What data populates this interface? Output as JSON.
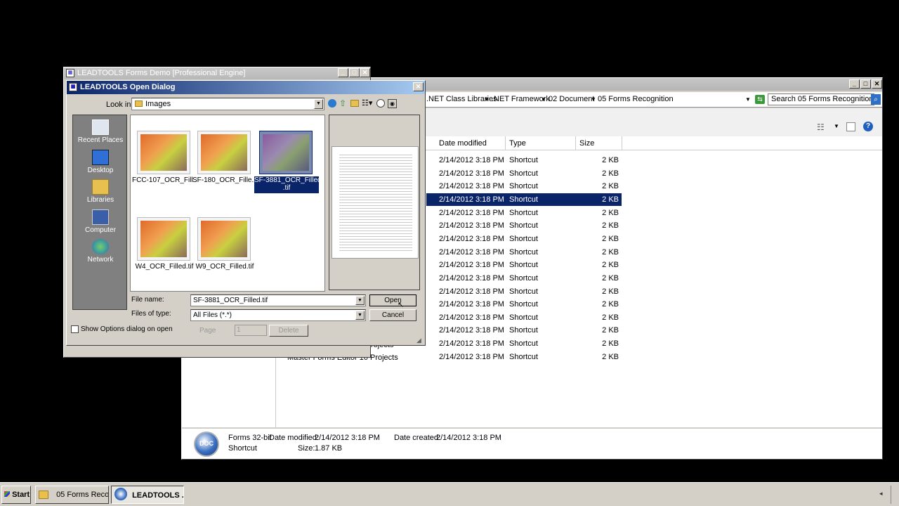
{
  "explorer": {
    "breadcrumb": [
      ".NET Class Libraries",
      ".NET Framework",
      "02 Document",
      "05 Forms Recognition"
    ],
    "search_placeholder": "Search 05 Forms Recognition",
    "columns": [
      "Date modified",
      "Type",
      "Size"
    ],
    "rows": [
      {
        "date": "2/14/2012 3:18 PM",
        "type": "Shortcut",
        "size": "2 KB"
      },
      {
        "date": "2/14/2012 3:18 PM",
        "type": "Shortcut",
        "size": "2 KB"
      },
      {
        "date": "2/14/2012 3:18 PM",
        "type": "Shortcut",
        "size": "2 KB"
      },
      {
        "date": "2/14/2012 3:18 PM",
        "type": "Shortcut",
        "size": "2 KB"
      },
      {
        "date": "2/14/2012 3:18 PM",
        "type": "Shortcut",
        "size": "2 KB"
      },
      {
        "date": "2/14/2012 3:18 PM",
        "type": "Shortcut",
        "size": "2 KB"
      },
      {
        "date": "2/14/2012 3:18 PM",
        "type": "Shortcut",
        "size": "2 KB"
      },
      {
        "date": "2/14/2012 3:18 PM",
        "type": "Shortcut",
        "size": "2 KB"
      },
      {
        "date": "2/14/2012 3:18 PM",
        "type": "Shortcut",
        "size": "2 KB"
      },
      {
        "date": "2/14/2012 3:18 PM",
        "type": "Shortcut",
        "size": "2 KB"
      },
      {
        "date": "2/14/2012 3:18 PM",
        "type": "Shortcut",
        "size": "2 KB"
      },
      {
        "date": "2/14/2012 3:18 PM",
        "type": "Shortcut",
        "size": "2 KB"
      },
      {
        "date": "2/14/2012 3:18 PM",
        "type": "Shortcut",
        "size": "2 KB"
      },
      {
        "date": "2/14/2012 3:18 PM",
        "type": "Shortcut",
        "size": "2 KB"
      },
      {
        "date": "2/14/2012 3:18 PM",
        "type": "Shortcut",
        "size": "2 KB"
      },
      {
        "date": "2/14/2012 3:18 PM",
        "type": "Shortcut",
        "size": "2 KB"
      }
    ],
    "partial_names": [
      "rojects",
      "Master Forms Editor 16 Projects"
    ],
    "details": {
      "name": "Forms 32-bit",
      "date_modified_label": "Date modified:",
      "date_modified": "2/14/2012 3:18 PM",
      "date_created_label": "Date created:",
      "date_created": "2/14/2012 3:18 PM",
      "type": "Shortcut",
      "size_label": "Size:",
      "size": "1.87 KB"
    }
  },
  "formsdemo": {
    "title": "LEADTOOLS Forms Demo [Professional Engine]"
  },
  "opendlg": {
    "title": "LEADTOOLS Open Dialog",
    "look_in_label": "Look in",
    "look_in_value": "Images",
    "places": [
      "Recent Places",
      "Desktop",
      "Libraries",
      "Computer",
      "Network"
    ],
    "files": [
      {
        "name": "FCC-107_OCR_Fill...",
        "selected": false
      },
      {
        "name": "SF-180_OCR_Fille...",
        "selected": false
      },
      {
        "name": "SF-3881_OCR_Filled",
        "name2": ".tif",
        "selected": true
      },
      {
        "name": "W4_OCR_Filled.tif",
        "selected": false
      },
      {
        "name": "W9_OCR_Filled.tif",
        "selected": false
      }
    ],
    "file_name_label": "File name:",
    "file_name_value": "SF-3881_OCR_Filled.tif",
    "files_of_type_label": "Files of type:",
    "files_of_type_value": "All Files (*.*)",
    "open_label": "Open",
    "cancel_label": "Cancel",
    "show_options_label": "Show Options dialog on open",
    "page_label": "Page",
    "page_value": "1",
    "delete_label": "Delete"
  },
  "taskbar": {
    "start_label": "Start",
    "items": [
      {
        "label": "05 Forms Reco...",
        "active": false
      },
      {
        "label": "LEADTOOLS ...",
        "active": true
      }
    ]
  }
}
